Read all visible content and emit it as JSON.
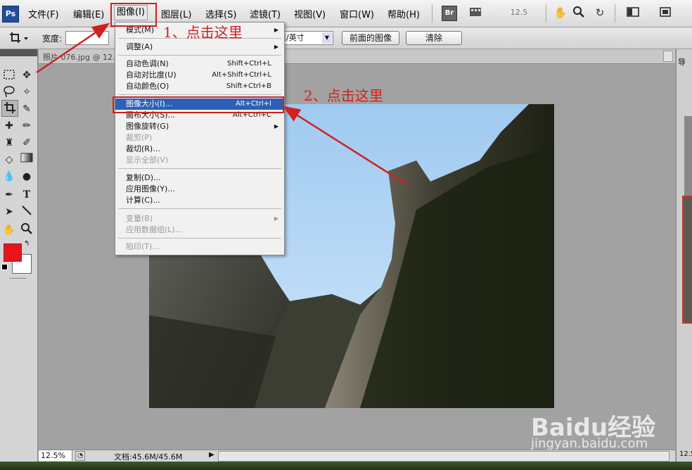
{
  "app": {
    "logo": "Ps"
  },
  "menubar": {
    "items": [
      {
        "label": "文件(F)"
      },
      {
        "label": "编辑(E)"
      },
      {
        "label": "图像(I)"
      },
      {
        "label": "图层(L)"
      },
      {
        "label": "选择(S)"
      },
      {
        "label": "滤镜(T)"
      },
      {
        "label": "视图(V)"
      },
      {
        "label": "窗口(W)"
      },
      {
        "label": "帮助(H)"
      }
    ],
    "br_label": "Br",
    "zoom_value": "12.5"
  },
  "options": {
    "width_label": "宽度:",
    "resolution_unit": "像素/英寸",
    "front_image_button": "前面的图像",
    "clear_button": "清除"
  },
  "document": {
    "tab_title": "照片 076.jpg @ 12..."
  },
  "image_menu": {
    "items": [
      {
        "label": "模式(M)",
        "submenu": true
      },
      {
        "label": "调整(A)",
        "submenu": true
      },
      {
        "label": "自动色调(N)",
        "shortcut": "Shift+Ctrl+L"
      },
      {
        "label": "自动对比度(U)",
        "shortcut": "Alt+Shift+Ctrl+L"
      },
      {
        "label": "自动颜色(O)",
        "shortcut": "Shift+Ctrl+B"
      },
      {
        "label": "图像大小(I)...",
        "shortcut": "Alt+Ctrl+I",
        "highlighted": true
      },
      {
        "label": "画布大小(S)...",
        "shortcut": "Alt+Ctrl+C"
      },
      {
        "label": "图像旋转(G)",
        "submenu": true
      },
      {
        "label": "裁剪(P)",
        "disabled": true
      },
      {
        "label": "裁切(R)..."
      },
      {
        "label": "显示全部(V)",
        "disabled": true
      },
      {
        "label": "复制(D)..."
      },
      {
        "label": "应用图像(Y)..."
      },
      {
        "label": "计算(C)..."
      },
      {
        "label": "变量(B)",
        "submenu": true,
        "disabled": true
      },
      {
        "label": "应用数据组(L)...",
        "disabled": true
      },
      {
        "label": "陷印(T)...",
        "disabled": true
      }
    ]
  },
  "annotations": {
    "step1": "1、点击这里",
    "step2": "2、点击这里"
  },
  "status": {
    "zoom": "12.5%",
    "doc_size": "文档:45.6M/45.6M"
  },
  "right_panel": {
    "tab_label": "导",
    "zoom": "12.5"
  },
  "watermark": {
    "brand": "Baidu经验",
    "url": "jingyan.baidu.com"
  },
  "colors": {
    "foreground": "#e8141b",
    "background": "#ffffff",
    "accent": "#d0201f",
    "highlight": "#2e5fb5"
  }
}
